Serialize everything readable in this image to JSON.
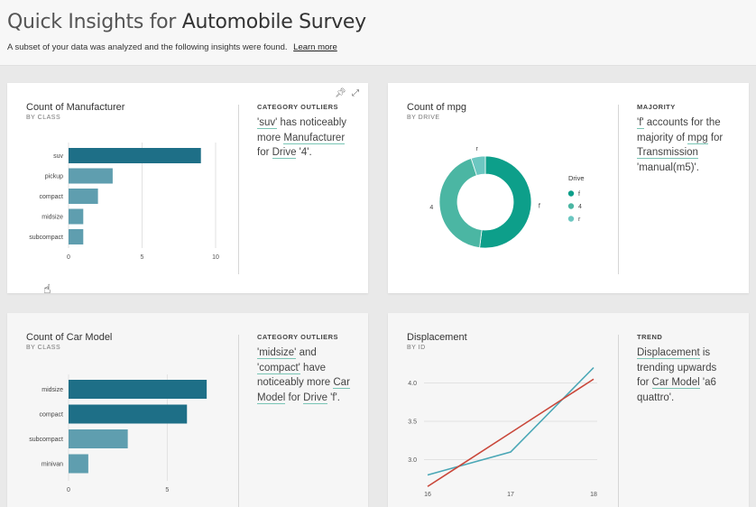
{
  "header": {
    "title_prefix": "Quick Insights for ",
    "title_dataset": "Automobile Survey",
    "subtitle": "A subset of your data was analyzed and the following insights were found.",
    "learn_more": "Learn more"
  },
  "cards": [
    {
      "title": "Count of Manufacturer",
      "subtitle": "BY CLASS",
      "insight_head": "CATEGORY OUTLIERS",
      "insight_parts": [
        {
          "t": "'suv'",
          "hl": true
        },
        {
          "t": " has noticeably more ",
          "hl": false
        },
        {
          "t": "Manufacturer",
          "hl": true
        },
        {
          "t": " for ",
          "hl": false
        },
        {
          "t": "Drive",
          "hl": true
        },
        {
          "t": " '4'.",
          "hl": false
        }
      ]
    },
    {
      "title": "Count of mpg",
      "subtitle": "BY DRIVE",
      "insight_head": "MAJORITY",
      "insight_parts": [
        {
          "t": "'f'",
          "hl": true
        },
        {
          "t": " accounts for the majority of ",
          "hl": false
        },
        {
          "t": "mpg",
          "hl": true
        },
        {
          "t": " for ",
          "hl": false
        },
        {
          "t": "Transmission",
          "hl": true
        },
        {
          "t": " 'manual(m5)'.",
          "hl": false
        }
      ]
    },
    {
      "title": "Count of Car Model",
      "subtitle": "BY CLASS",
      "insight_head": "CATEGORY OUTLIERS",
      "insight_parts": [
        {
          "t": "'midsize'",
          "hl": true
        },
        {
          "t": " and ",
          "hl": false
        },
        {
          "t": "'compact'",
          "hl": true
        },
        {
          "t": " have noticeably more ",
          "hl": false
        },
        {
          "t": "Car Model",
          "hl": true
        },
        {
          "t": " for ",
          "hl": false
        },
        {
          "t": "Drive",
          "hl": true
        },
        {
          "t": " 'f'.",
          "hl": false
        }
      ]
    },
    {
      "title": "Displacement",
      "subtitle": "BY ID",
      "insight_head": "TREND",
      "insight_parts": [
        {
          "t": "Displacement",
          "hl": true
        },
        {
          "t": " is trending upwards for ",
          "hl": false
        },
        {
          "t": "Car Model",
          "hl": true
        },
        {
          "t": " 'a6 quattro'.",
          "hl": false
        }
      ]
    }
  ],
  "colors": {
    "bar_highlight": "#1e6f87",
    "bar_normal": "#5f9eaf",
    "donut_f": "#0d9f8a",
    "donut_4": "#4bb6a3",
    "donut_r": "#6cc7c1",
    "trend_line": "#c9473a",
    "data_line": "#4aa7b6",
    "grid": "#e2e2e2"
  },
  "chart_data": [
    {
      "type": "bar",
      "orientation": "horizontal",
      "categories": [
        "suv",
        "pickup",
        "compact",
        "midsize",
        "subcompact"
      ],
      "values": [
        9,
        3,
        2,
        1,
        1
      ],
      "highlight": [
        "suv"
      ],
      "xlim": [
        0,
        10
      ],
      "xticks": [
        "0",
        "5",
        "10"
      ],
      "grid": true
    },
    {
      "type": "pie",
      "donut": true,
      "slices": [
        {
          "label": "f",
          "value": 52
        },
        {
          "label": "4",
          "value": 43
        },
        {
          "label": "r",
          "value": 5
        }
      ],
      "legend_title": "Drive",
      "legend": [
        "f",
        "4",
        "r"
      ],
      "legend_position": "right"
    },
    {
      "type": "bar",
      "orientation": "horizontal",
      "categories": [
        "midsize",
        "compact",
        "subcompact",
        "minivan"
      ],
      "values": [
        7,
        6,
        3,
        1
      ],
      "highlight": [
        "midsize",
        "compact"
      ],
      "xlim": [
        0,
        8
      ],
      "xticks": [
        "0",
        "5"
      ],
      "grid": true
    },
    {
      "type": "line",
      "x": [
        16,
        17,
        18
      ],
      "xticks": [
        "16",
        "17",
        "18"
      ],
      "yticks": [
        "3.0",
        "3.5",
        "4.0"
      ],
      "ylim": [
        2.7,
        4.3
      ],
      "series": [
        {
          "role": "data",
          "values": [
            2.8,
            3.1,
            4.2
          ]
        },
        {
          "role": "trend",
          "values": [
            2.65,
            3.35,
            4.05
          ]
        }
      ],
      "grid": true
    }
  ]
}
